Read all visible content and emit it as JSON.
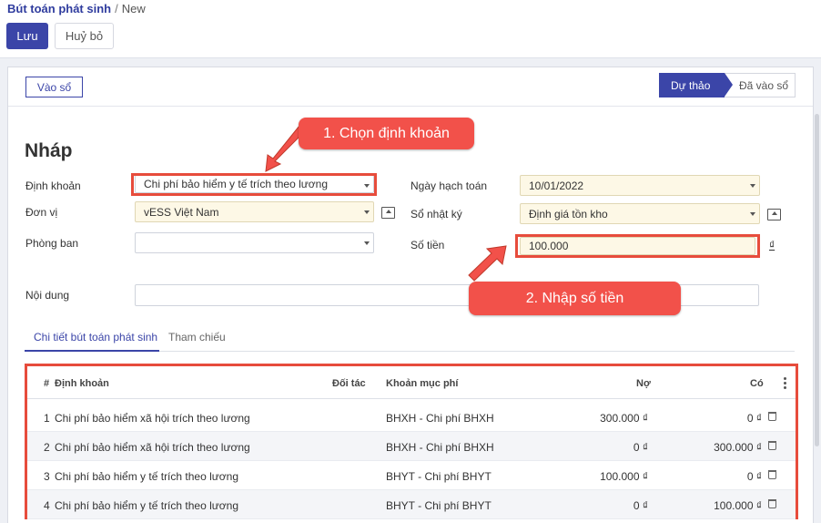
{
  "breadcrumb": {
    "parent": "Bút toán phát sinh",
    "separator": "/",
    "current": "New"
  },
  "toolbar": {
    "save_label": "Lưu",
    "cancel_label": "Huỷ bỏ"
  },
  "status": {
    "post_button": "Vào sổ",
    "stages": [
      "Dự thảo",
      "Đã vào sổ"
    ],
    "active_stage": "Dự thảo"
  },
  "form": {
    "title": "Nháp",
    "labels": {
      "account_rule": "Định khoản",
      "unit": "Đơn vị",
      "department": "Phòng ban",
      "description": "Nội dung",
      "accounting_date": "Ngày hạch toán",
      "journal": "Sổ nhật ký",
      "amount": "Số tiền"
    },
    "values": {
      "account_rule": "Chi phí bảo hiểm y tế trích theo lương",
      "unit": "vESS Việt Nam",
      "department": "",
      "description": "",
      "accounting_date": "10/01/2022",
      "journal": "Định giá tồn kho",
      "amount": "100.000"
    },
    "currency_symbol": "₫"
  },
  "callouts": {
    "step1": "1. Chọn định khoản",
    "step2": "2. Nhập số tiền"
  },
  "tabs": [
    "Chi tiết bút toán phát sinh",
    "Tham chiếu"
  ],
  "table": {
    "headers": [
      "#",
      "Định khoản",
      "Đối tác",
      "Khoản mục phí",
      "Nợ",
      "Có"
    ],
    "rows": [
      {
        "num": "1",
        "account": "Chi phí bảo hiểm xã hội trích theo lương",
        "partner": "",
        "cost_item": "BHXH - Chi phí BHXH",
        "debit": "300.000 ₫",
        "credit": "0 ₫"
      },
      {
        "num": "2",
        "account": "Chi phí bảo hiểm xã hội trích theo lương",
        "partner": "",
        "cost_item": "BHXH - Chi phí BHXH",
        "debit": "0 ₫",
        "credit": "300.000 ₫"
      },
      {
        "num": "3",
        "account": "Chi phí bảo hiểm y tế trích theo lương",
        "partner": "",
        "cost_item": "BHYT - Chi phí BHYT",
        "debit": "100.000 ₫",
        "credit": "0 ₫"
      },
      {
        "num": "4",
        "account": "Chi phí bảo hiểm y tế trích theo lương",
        "partner": "",
        "cost_item": "BHYT - Chi phí BHYT",
        "debit": "0 ₫",
        "credit": "100.000 ₫"
      }
    ]
  },
  "colors": {
    "primary": "#3b45a8",
    "highlight": "#e74c3c",
    "callout": "#f2514a",
    "required_field": "#fdf8e6"
  }
}
